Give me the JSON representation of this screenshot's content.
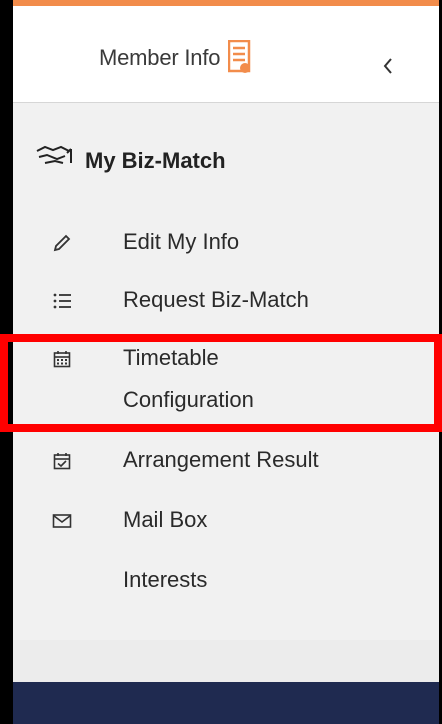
{
  "header": {
    "member_info_label": "Member Info",
    "collapse_icon": "chevron-left-icon"
  },
  "section": {
    "title": "My Biz-Match",
    "icon": "handshake-icon"
  },
  "menu": {
    "items": [
      {
        "label": "Edit My Info",
        "icon": "pencil-icon"
      },
      {
        "label": "Request Biz-Match",
        "icon": "list-icon"
      },
      {
        "label": "Timetable Configuration",
        "label_line1": "Timetable",
        "label_line2": "Configuration",
        "icon": "calendar-icon",
        "highlighted": true
      },
      {
        "label": "Arrangement Result",
        "icon": "calendar-check-icon"
      },
      {
        "label": "Mail Box",
        "icon": "mail-icon"
      },
      {
        "label": "Interests",
        "icon": ""
      }
    ]
  },
  "colors": {
    "accent_orange": "#f28c4b",
    "highlight_red": "#ff0000",
    "footer_navy": "#1f2a50"
  }
}
